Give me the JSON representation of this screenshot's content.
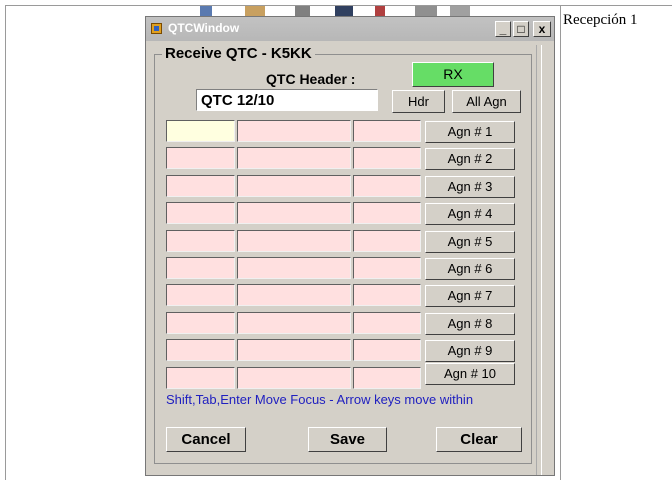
{
  "desktop": {
    "caption": "Recepción 1"
  },
  "window": {
    "title": "QTCWindow",
    "controls": {
      "minimize": "_",
      "maximize": "□",
      "close": "x"
    }
  },
  "form": {
    "group_title": "Receive QTC - K5KK",
    "header_label": "QTC Header :",
    "header_value": "QTC 12/10",
    "rx_label": "RX",
    "hdr_label": "Hdr",
    "all_agn_label": "All Agn",
    "rows": [
      {
        "time": "",
        "call": "",
        "number": "",
        "agn_label": "Agn # 1"
      },
      {
        "time": "",
        "call": "",
        "number": "",
        "agn_label": "Agn # 2"
      },
      {
        "time": "",
        "call": "",
        "number": "",
        "agn_label": "Agn # 3"
      },
      {
        "time": "",
        "call": "",
        "number": "",
        "agn_label": "Agn # 4"
      },
      {
        "time": "",
        "call": "",
        "number": "",
        "agn_label": "Agn # 5"
      },
      {
        "time": "",
        "call": "",
        "number": "",
        "agn_label": "Agn # 6"
      },
      {
        "time": "",
        "call": "",
        "number": "",
        "agn_label": "Agn # 7"
      },
      {
        "time": "",
        "call": "",
        "number": "",
        "agn_label": "Agn # 8"
      },
      {
        "time": "",
        "call": "",
        "number": "",
        "agn_label": "Agn # 9"
      },
      {
        "time": "",
        "call": "",
        "number": "",
        "agn_label": "Agn # 10"
      }
    ],
    "hint": "Shift,Tab,Enter Move Focus - Arrow keys move within",
    "cancel_label": "Cancel",
    "save_label": "Save",
    "clear_label": "Clear"
  },
  "colors": {
    "rx_button": "#66dd66",
    "cell_bg": "#ffe0e0",
    "focus_cell_bg": "#ffffe0",
    "hint_text": "#2020c0"
  }
}
